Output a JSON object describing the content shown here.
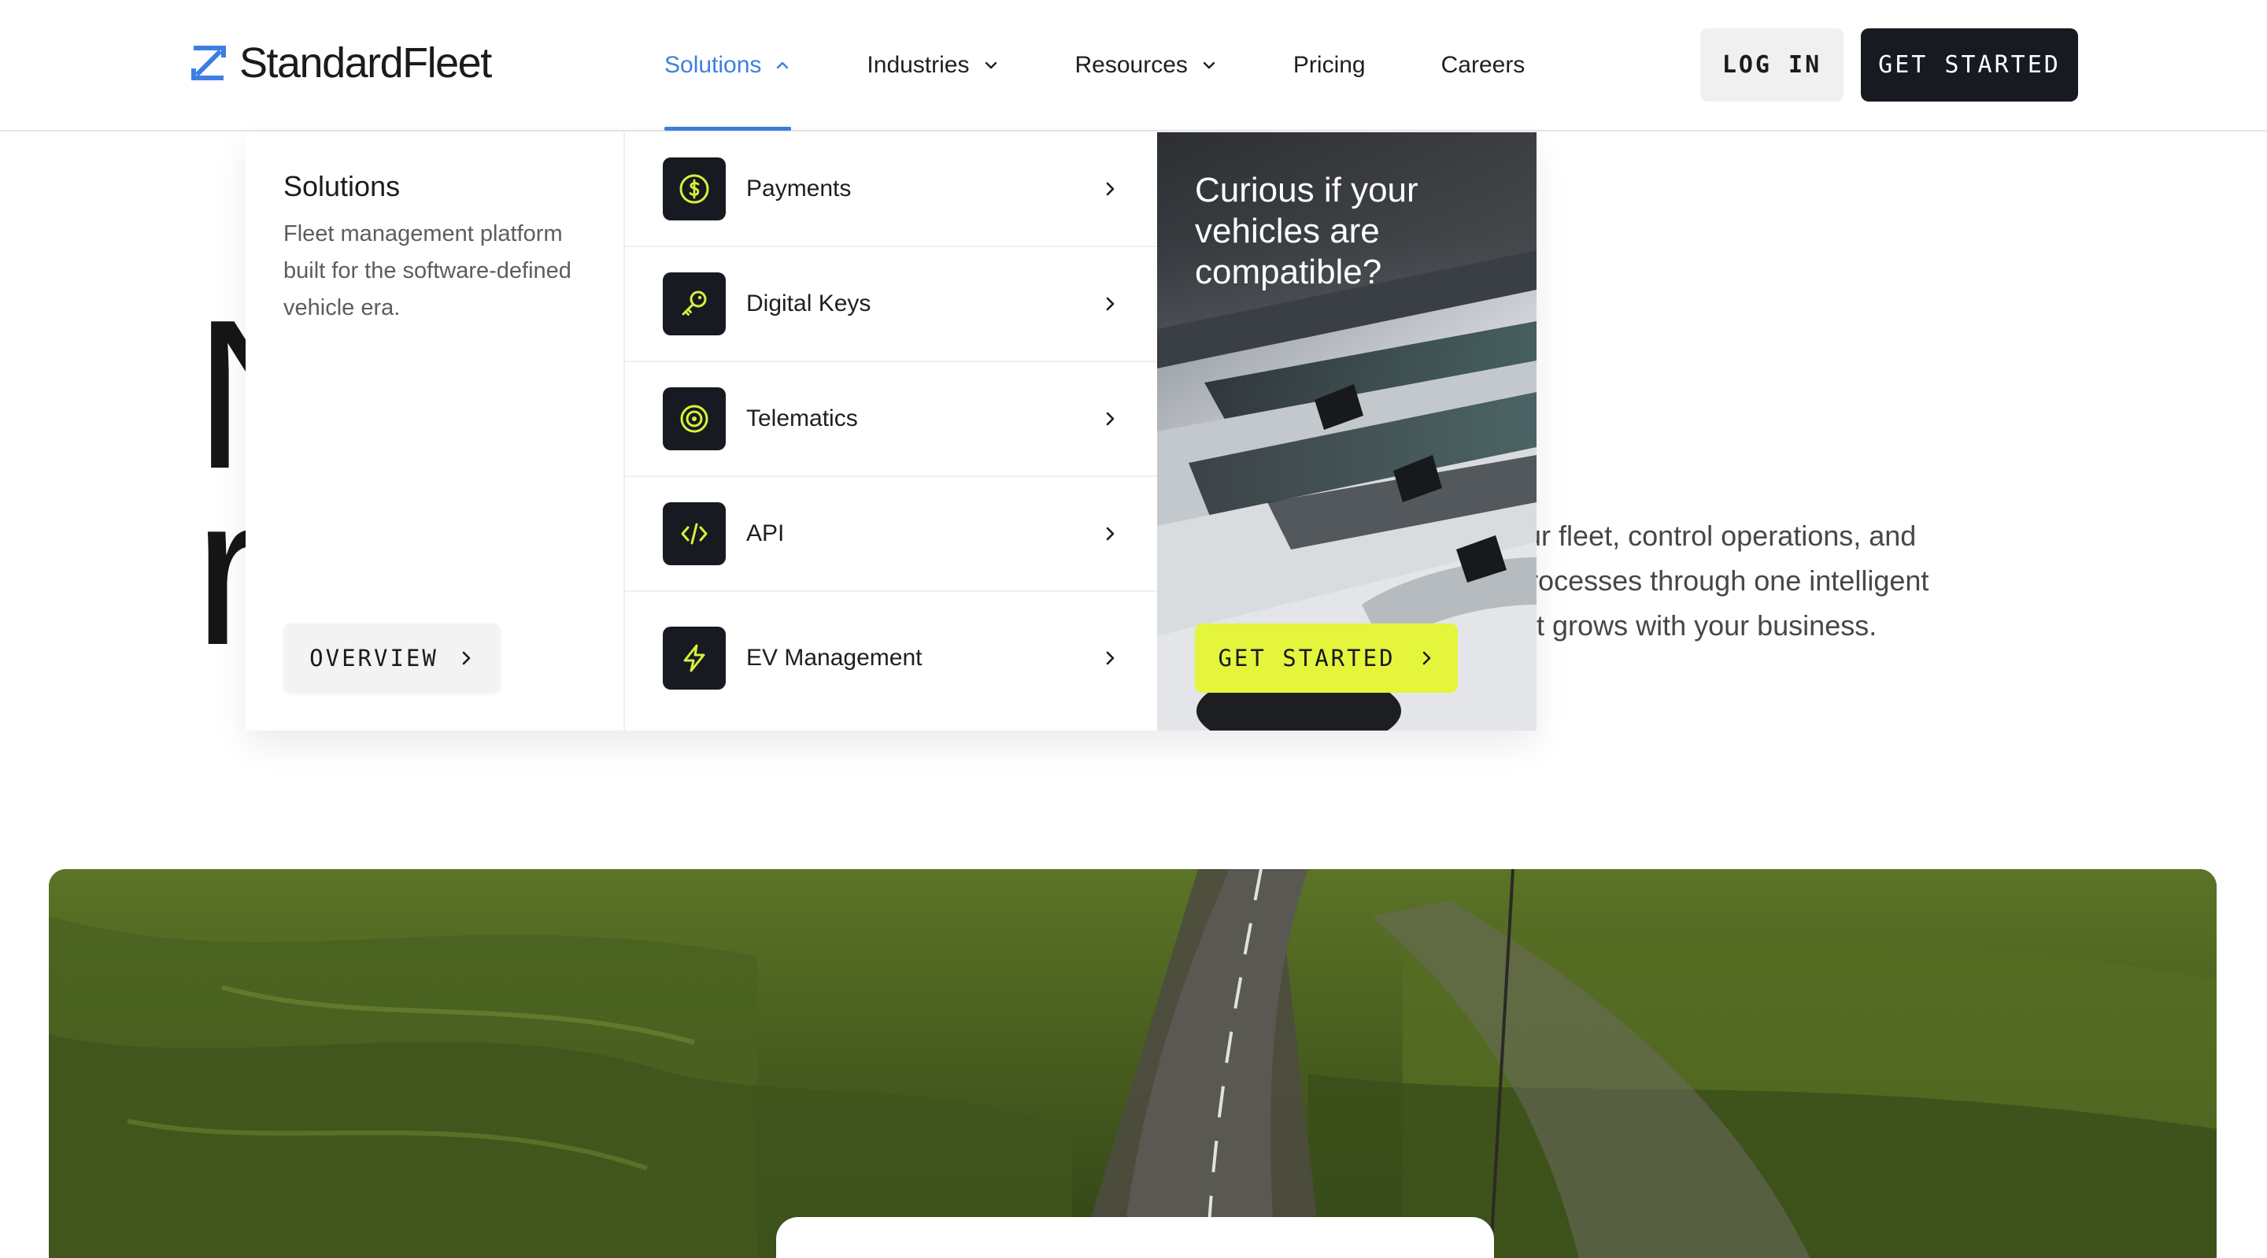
{
  "header": {
    "brand": "StandardFleet",
    "nav": [
      {
        "label": "Solutions",
        "has_dropdown": true,
        "active": true
      },
      {
        "label": "Industries",
        "has_dropdown": true,
        "active": false
      },
      {
        "label": "Resources",
        "has_dropdown": true,
        "active": false
      },
      {
        "label": "Pricing",
        "has_dropdown": false,
        "active": false
      },
      {
        "label": "Careers",
        "has_dropdown": false,
        "active": false
      }
    ],
    "login_label": "LOG IN",
    "get_started_label": "GET STARTED"
  },
  "hero": {
    "headline_visible": "N\nr",
    "paragraph_visible": "ct your fleet, control operations, and\nate processes through one intelligent\nm that grows with your business."
  },
  "mega_menu": {
    "intro": {
      "title": "Solutions",
      "description": "Fleet management platform built for the software-defined vehicle era.",
      "overview_label": "OVERVIEW"
    },
    "items": [
      {
        "label": "Payments",
        "icon": "dollar-coin-icon"
      },
      {
        "label": "Digital Keys",
        "icon": "key-icon"
      },
      {
        "label": "Telematics",
        "icon": "signal-icon"
      },
      {
        "label": "API",
        "icon": "code-icon"
      },
      {
        "label": "EV Management",
        "icon": "lightning-icon"
      }
    ],
    "promo": {
      "title": "Curious if your vehicles are compatible?",
      "button_label": "GET STARTED"
    }
  },
  "colors": {
    "accent_blue": "#3d7fe0",
    "dark": "#171a20",
    "lime": "#e4f53c",
    "icon_lime": "#d8f03c"
  }
}
